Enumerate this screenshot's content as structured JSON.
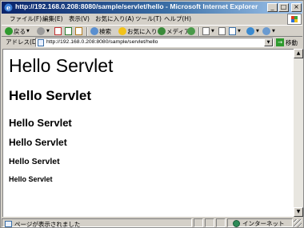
{
  "window": {
    "title": "http://192.168.0.208:8080/sample/servlet/hello - Microsoft Internet Explorer",
    "controls": {
      "minimize": "_",
      "maximize": "□",
      "close": "×"
    }
  },
  "menu": {
    "file": "ファイル(F)",
    "edit": "編集(E)",
    "view": "表示(V)",
    "favorites": "お気に入り(A)",
    "tools": "ツール(T)",
    "help": "ヘルプ(H)"
  },
  "toolbar": {
    "back": "戻る",
    "search": "検索",
    "favorites": "お気に入り",
    "media": "メディア"
  },
  "address": {
    "label": "アドレス(D)",
    "url": "http://192.168.0.208:8080/sample/servlet/hello",
    "go": "移動"
  },
  "content": {
    "h1": "Hello Servlet",
    "h2": "Hello Servlet",
    "h3": "Hello Servlet",
    "h4": "Hello Servlet",
    "h5": "Hello Servlet",
    "h6": "Hello Servlet"
  },
  "status": {
    "message": "ページが表示されました",
    "zone": "インターネット"
  },
  "colors": {
    "titlebar_start": "#0a246a",
    "titlebar_end": "#a6caf0",
    "chrome": "#d4d0c8"
  }
}
